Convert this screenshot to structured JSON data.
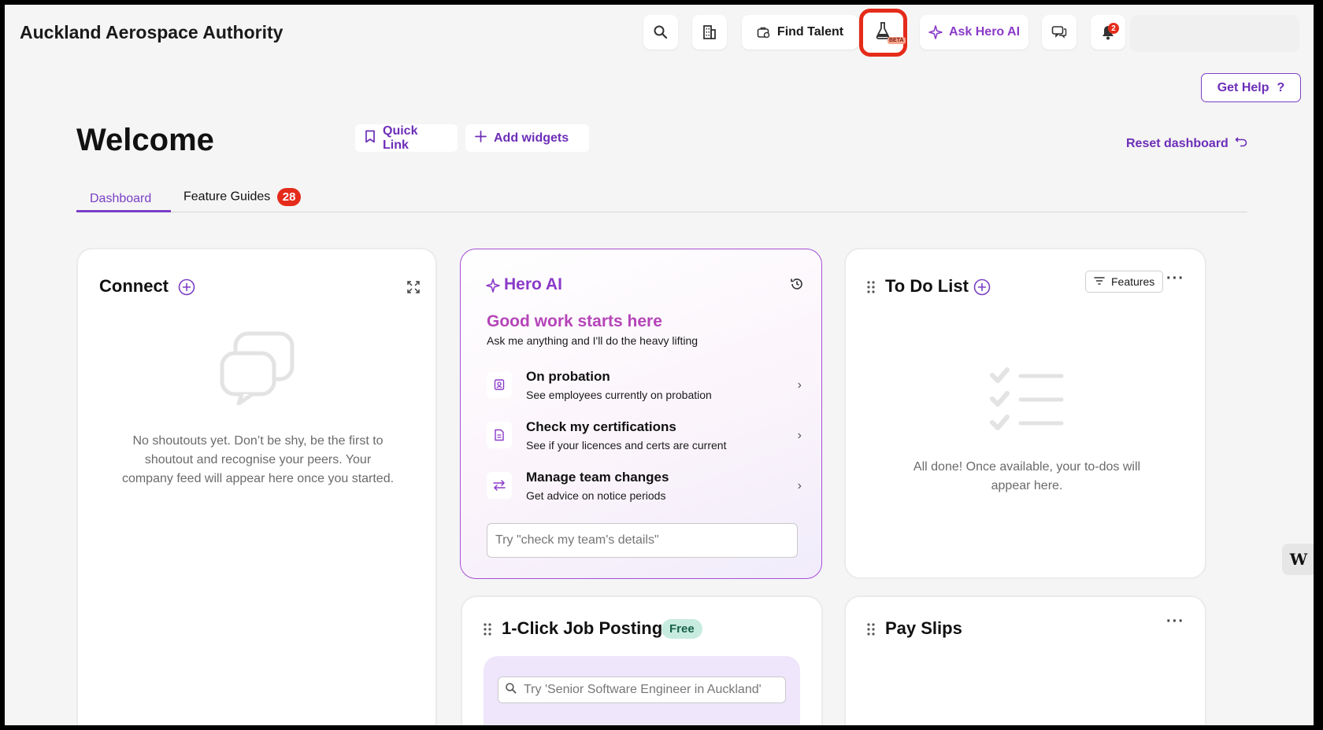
{
  "header": {
    "company_name": "Auckland Aerospace Authority",
    "find_talent_label": "Find Talent",
    "beta_label": "BETA",
    "ask_hero_label": "Ask Hero AI",
    "notification_count": "2",
    "get_help_label": "Get Help",
    "get_help_icon": "?"
  },
  "welcome": {
    "title": "Welcome",
    "quick_link_label": "Quick Link",
    "add_widgets_label": "Add widgets",
    "reset_label": "Reset dashboard"
  },
  "tabs": [
    {
      "label": "Dashboard",
      "active": true
    },
    {
      "label": "Feature Guides",
      "count": "28"
    }
  ],
  "connect": {
    "title": "Connect",
    "empty_text": "No shoutouts yet. Don’t be shy, be the first to shoutout and recognise your peers. Your company feed will appear here once you started."
  },
  "hero_ai": {
    "title": "Hero AI",
    "headline": "Good work starts here",
    "subtitle": "Ask me anything and I'll do the heavy lifting",
    "suggestions": [
      {
        "title": "On probation",
        "subtitle": "See employees currently on probation",
        "icon": "badge-icon"
      },
      {
        "title": "Check my certifications",
        "subtitle": "See if your licences and certs are current",
        "icon": "document-icon"
      },
      {
        "title": "Manage team changes",
        "subtitle": "Get advice on notice periods",
        "icon": "swap-icon"
      }
    ],
    "input_placeholder": "Try \"check my team's details\""
  },
  "todo": {
    "title": "To Do List",
    "features_label": "Features",
    "empty_text": "All done! Once available, your to-dos will appear here."
  },
  "job_posting": {
    "title": "1-Click Job Posting",
    "badge": "Free",
    "input_placeholder": "Try 'Senior Software Engineer in Auckland'"
  },
  "pay_slips": {
    "title": "Pay Slips"
  },
  "colors": {
    "accent": "#7b3fc6",
    "hero_gradient": "#b544b8",
    "badge_red": "#e52b1a",
    "free_badge_bg": "#c7ecdf"
  }
}
